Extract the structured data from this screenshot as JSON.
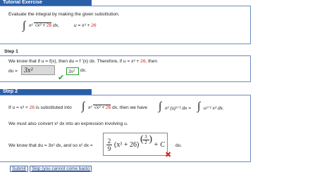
{
  "header": {
    "title": "Tutorial Exercise"
  },
  "intro": {
    "instruction": "Evaluate the integral by making the given substitution.",
    "integrand_power": "x²",
    "radical_base": "x³ + ",
    "constant": "26",
    "dx": "dx,",
    "substitution": "u = x³ + ",
    "substitution_const": "26"
  },
  "step1": {
    "title": "Step 1",
    "text_a": "We know that if  u = f(x),  then  du = f ′(x) dx.  Therefore, if  u = x³ + ",
    "text_const": "26",
    "text_b": ",  then",
    "du_label": "du =",
    "answer_value": "3x²",
    "hint_value": "3x²",
    "dx_label": "dx."
  },
  "step2": {
    "title": "Step 2",
    "line1_a": "If  u = x³ + ",
    "line1_const": "26",
    "line1_b": "  is substituted into",
    "line1_integrand": "x²",
    "line1_radical": "x³ + ",
    "line1_radical_const": "26",
    "line1_c": "dx,  then we have",
    "line1_d": "x² (u)¹ᐟ² dx =",
    "line1_e": "u¹ᐟ² x² dx.",
    "line2": "We must also convert  x² dx  into an expression involving u.",
    "line3_a": "We know that  du = 3x² dx,  and so  x² dx =",
    "answer_expr": {
      "coef_num": "2",
      "coef_den": "9",
      "inner": "(x³ + 26)",
      "exp_num": "3",
      "exp_den": "2",
      "tail": "+ C"
    },
    "line3_b": "du."
  },
  "buttons": {
    "submit": "Submit",
    "skip": "Skip (you cannot come back)"
  },
  "colors": {
    "header": "#2a5fa8",
    "accent_red": "#d4281e",
    "check_green": "#2a9a2a"
  }
}
